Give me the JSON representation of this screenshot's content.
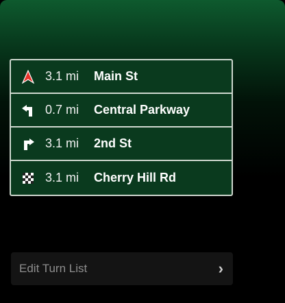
{
  "turn_list": {
    "items": [
      {
        "icon": "start-arrow-icon",
        "distance": "3.1 mi",
        "street": "Main St"
      },
      {
        "icon": "turn-left-icon",
        "distance": "0.7 mi",
        "street": "Central Parkway"
      },
      {
        "icon": "turn-right-icon",
        "distance": "3.1 mi",
        "street": "2nd St"
      },
      {
        "icon": "finish-flag-icon",
        "distance": "3.1 mi",
        "street": "Cherry Hill Rd"
      }
    ]
  },
  "edit_button": {
    "label": "Edit Turn List",
    "icon": "chevron-right-icon"
  },
  "colors": {
    "accent_green": "#0a3a1e",
    "start_arrow": "#e8332b"
  }
}
